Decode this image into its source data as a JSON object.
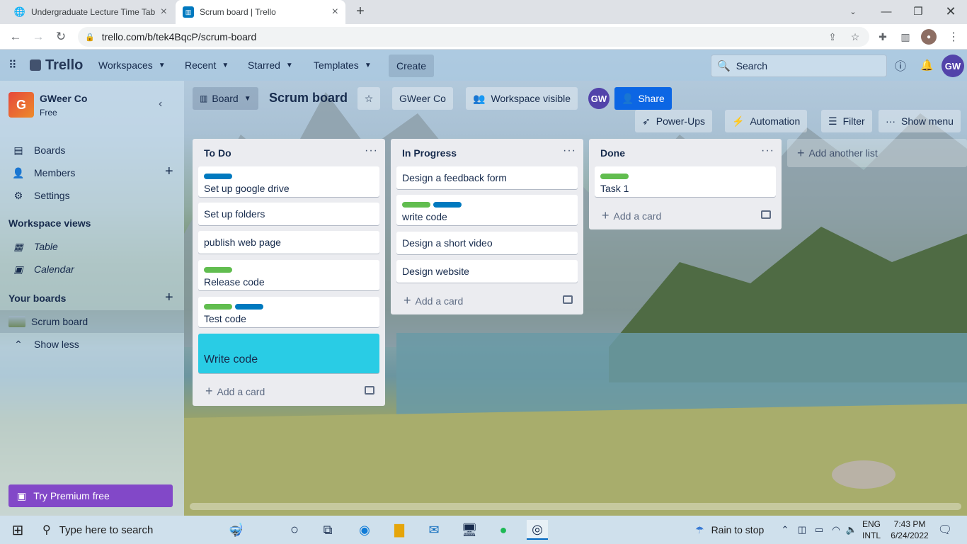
{
  "browser": {
    "tabs": [
      {
        "title": "Undergraduate Lecture Time Tab"
      },
      {
        "title": "Scrum board | Trello"
      }
    ],
    "url": "trello.com/b/tek4BqcP/scrum-board"
  },
  "header": {
    "logo": "Trello",
    "nav": [
      "Workspaces",
      "Recent",
      "Starred",
      "Templates"
    ],
    "create": "Create",
    "search_placeholder": "Search",
    "avatar": "GW"
  },
  "sidebar": {
    "workspace_initial": "G",
    "workspace_name": "GWeer Co",
    "plan": "Free",
    "items": [
      "Boards",
      "Members",
      "Settings"
    ],
    "views_title": "Workspace views",
    "views": [
      "Table",
      "Calendar"
    ],
    "boards_title": "Your boards",
    "boards": [
      "Scrum board"
    ],
    "show_less": "Show less",
    "premium": "Try Premium free"
  },
  "board": {
    "view": "Board",
    "title": "Scrum board",
    "workspace": "GWeer Co",
    "visibility": "Workspace visible",
    "member_avatar": "GW",
    "share": "Share",
    "powerups": "Power-Ups",
    "automation": "Automation",
    "filter": "Filter",
    "show_menu": "Show menu",
    "add_list": "Add another list",
    "add_card": "Add a card"
  },
  "lists": [
    {
      "title": "To Do",
      "cards": [
        "Set up google drive",
        "Set up folders",
        "publish web page",
        "Release code",
        "Test code",
        "Write code"
      ]
    },
    {
      "title": "In Progress",
      "cards": [
        "Design a feedback form",
        "write code",
        "Design a short video",
        "Design website"
      ]
    },
    {
      "title": "Done",
      "cards": [
        "Task 1"
      ]
    }
  ],
  "colors": {
    "green": "#61bd4f",
    "blue": "#0079bf",
    "cyan": "#29cce5",
    "premium": "#8248c8"
  },
  "taskbar": {
    "search": "Type here to search",
    "weather": "Rain to stop",
    "lang1": "ENG",
    "lang2": "INTL",
    "time": "7:43 PM",
    "date": "6/24/2022"
  }
}
